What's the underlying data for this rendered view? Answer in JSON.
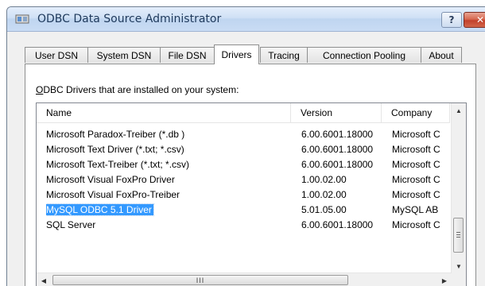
{
  "window": {
    "title": "ODBC Data Source Administrator",
    "help_label": "?",
    "close_label": "✕"
  },
  "tabs": [
    {
      "label": "User DSN"
    },
    {
      "label": "System DSN"
    },
    {
      "label": "File DSN"
    },
    {
      "label": "Drivers",
      "active": true
    },
    {
      "label": "Tracing"
    },
    {
      "label": "Connection Pooling"
    },
    {
      "label": "About"
    }
  ],
  "drivers_panel": {
    "section_label_accel": "O",
    "section_label_rest": "DBC Drivers that are installed on your system:",
    "columns": [
      "Name",
      "Version",
      "Company"
    ],
    "rows": [
      {
        "name": "Microsoft Paradox-Treiber (*.db )",
        "version": "6.00.6001.18000",
        "company": "Microsoft C"
      },
      {
        "name": "Microsoft Text Driver (*.txt; *.csv)",
        "version": "6.00.6001.18000",
        "company": "Microsoft C"
      },
      {
        "name": "Microsoft Text-Treiber (*.txt; *.csv)",
        "version": "6.00.6001.18000",
        "company": "Microsoft C"
      },
      {
        "name": "Microsoft Visual FoxPro Driver",
        "version": "1.00.02.00",
        "company": "Microsoft C"
      },
      {
        "name": "Microsoft Visual FoxPro-Treiber",
        "version": "1.00.02.00",
        "company": "Microsoft C"
      },
      {
        "name": "MySQL ODBC 5.1 Driver",
        "version": "5.01.05.00",
        "company": "MySQL AB",
        "selected": true
      },
      {
        "name": "SQL Server",
        "version": "6.00.6001.18000",
        "company": "Microsoft C"
      }
    ],
    "hscroll_thumb_glyph": "III"
  },
  "colors": {
    "selection": "#3399ff",
    "window_bg": "#f0f0f0",
    "close_button": "#c2402b"
  }
}
